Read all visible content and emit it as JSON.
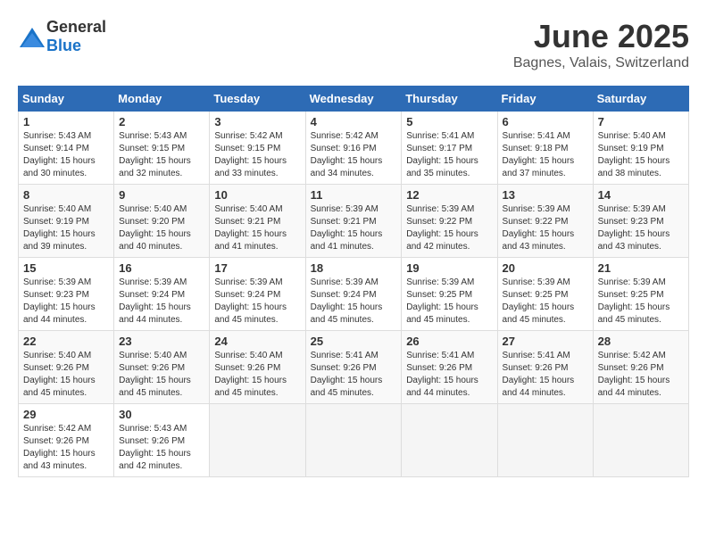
{
  "logo": {
    "text_general": "General",
    "text_blue": "Blue"
  },
  "title": "June 2025",
  "location": "Bagnes, Valais, Switzerland",
  "days_header": [
    "Sunday",
    "Monday",
    "Tuesday",
    "Wednesday",
    "Thursday",
    "Friday",
    "Saturday"
  ],
  "weeks": [
    [
      {
        "day": "1",
        "sunrise": "5:43 AM",
        "sunset": "9:14 PM",
        "daylight": "15 hours and 30 minutes."
      },
      {
        "day": "2",
        "sunrise": "5:43 AM",
        "sunset": "9:15 PM",
        "daylight": "15 hours and 32 minutes."
      },
      {
        "day": "3",
        "sunrise": "5:42 AM",
        "sunset": "9:15 PM",
        "daylight": "15 hours and 33 minutes."
      },
      {
        "day": "4",
        "sunrise": "5:42 AM",
        "sunset": "9:16 PM",
        "daylight": "15 hours and 34 minutes."
      },
      {
        "day": "5",
        "sunrise": "5:41 AM",
        "sunset": "9:17 PM",
        "daylight": "15 hours and 35 minutes."
      },
      {
        "day": "6",
        "sunrise": "5:41 AM",
        "sunset": "9:18 PM",
        "daylight": "15 hours and 37 minutes."
      },
      {
        "day": "7",
        "sunrise": "5:40 AM",
        "sunset": "9:19 PM",
        "daylight": "15 hours and 38 minutes."
      }
    ],
    [
      {
        "day": "8",
        "sunrise": "5:40 AM",
        "sunset": "9:19 PM",
        "daylight": "15 hours and 39 minutes."
      },
      {
        "day": "9",
        "sunrise": "5:40 AM",
        "sunset": "9:20 PM",
        "daylight": "15 hours and 40 minutes."
      },
      {
        "day": "10",
        "sunrise": "5:40 AM",
        "sunset": "9:21 PM",
        "daylight": "15 hours and 41 minutes."
      },
      {
        "day": "11",
        "sunrise": "5:39 AM",
        "sunset": "9:21 PM",
        "daylight": "15 hours and 41 minutes."
      },
      {
        "day": "12",
        "sunrise": "5:39 AM",
        "sunset": "9:22 PM",
        "daylight": "15 hours and 42 minutes."
      },
      {
        "day": "13",
        "sunrise": "5:39 AM",
        "sunset": "9:22 PM",
        "daylight": "15 hours and 43 minutes."
      },
      {
        "day": "14",
        "sunrise": "5:39 AM",
        "sunset": "9:23 PM",
        "daylight": "15 hours and 43 minutes."
      }
    ],
    [
      {
        "day": "15",
        "sunrise": "5:39 AM",
        "sunset": "9:23 PM",
        "daylight": "15 hours and 44 minutes."
      },
      {
        "day": "16",
        "sunrise": "5:39 AM",
        "sunset": "9:24 PM",
        "daylight": "15 hours and 44 minutes."
      },
      {
        "day": "17",
        "sunrise": "5:39 AM",
        "sunset": "9:24 PM",
        "daylight": "15 hours and 45 minutes."
      },
      {
        "day": "18",
        "sunrise": "5:39 AM",
        "sunset": "9:24 PM",
        "daylight": "15 hours and 45 minutes."
      },
      {
        "day": "19",
        "sunrise": "5:39 AM",
        "sunset": "9:25 PM",
        "daylight": "15 hours and 45 minutes."
      },
      {
        "day": "20",
        "sunrise": "5:39 AM",
        "sunset": "9:25 PM",
        "daylight": "15 hours and 45 minutes."
      },
      {
        "day": "21",
        "sunrise": "5:39 AM",
        "sunset": "9:25 PM",
        "daylight": "15 hours and 45 minutes."
      }
    ],
    [
      {
        "day": "22",
        "sunrise": "5:40 AM",
        "sunset": "9:26 PM",
        "daylight": "15 hours and 45 minutes."
      },
      {
        "day": "23",
        "sunrise": "5:40 AM",
        "sunset": "9:26 PM",
        "daylight": "15 hours and 45 minutes."
      },
      {
        "day": "24",
        "sunrise": "5:40 AM",
        "sunset": "9:26 PM",
        "daylight": "15 hours and 45 minutes."
      },
      {
        "day": "25",
        "sunrise": "5:41 AM",
        "sunset": "9:26 PM",
        "daylight": "15 hours and 45 minutes."
      },
      {
        "day": "26",
        "sunrise": "5:41 AM",
        "sunset": "9:26 PM",
        "daylight": "15 hours and 44 minutes."
      },
      {
        "day": "27",
        "sunrise": "5:41 AM",
        "sunset": "9:26 PM",
        "daylight": "15 hours and 44 minutes."
      },
      {
        "day": "28",
        "sunrise": "5:42 AM",
        "sunset": "9:26 PM",
        "daylight": "15 hours and 44 minutes."
      }
    ],
    [
      {
        "day": "29",
        "sunrise": "5:42 AM",
        "sunset": "9:26 PM",
        "daylight": "15 hours and 43 minutes."
      },
      {
        "day": "30",
        "sunrise": "5:43 AM",
        "sunset": "9:26 PM",
        "daylight": "15 hours and 42 minutes."
      },
      null,
      null,
      null,
      null,
      null
    ]
  ]
}
